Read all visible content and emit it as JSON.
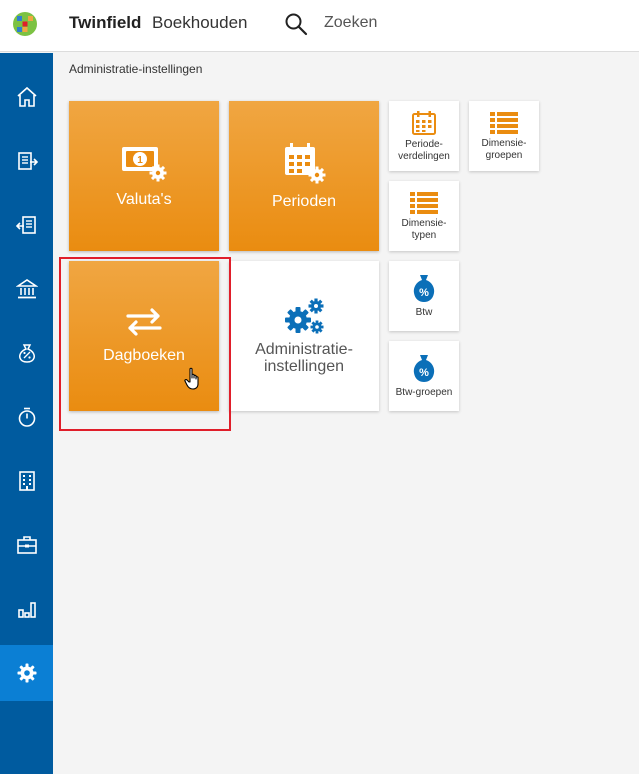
{
  "header": {
    "brand": "Twinfield",
    "product": "Boekhouden",
    "search_label": "Zoeken"
  },
  "breadcrumb": "Administratie-instellingen",
  "sidebar": {
    "items": [
      {
        "icon": "home-icon"
      },
      {
        "icon": "sales-invoice-icon"
      },
      {
        "icon": "purchase-invoice-icon"
      },
      {
        "icon": "bank-icon"
      },
      {
        "icon": "tax-icon"
      },
      {
        "icon": "timer-icon"
      },
      {
        "icon": "building-icon"
      },
      {
        "icon": "briefcase-icon"
      },
      {
        "icon": "reports-icon"
      },
      {
        "icon": "settings-icon",
        "active": true
      }
    ]
  },
  "tiles": {
    "valuta": "Valuta's",
    "perioden": "Perioden",
    "dagboeken": "Dagboeken",
    "administratie": "Administratie-\ninstellingen",
    "periodeverdelingen": "Periode-\nverdelingen",
    "dimensiegroepen": "Dimensie-\ngroepen",
    "dimensietypen": "Dimensie-\ntypen",
    "btw": "Btw",
    "btwgroepen": "Btw-groepen"
  },
  "colors": {
    "sidebar": "#005b9f",
    "sidebar_active": "#0b7fd4",
    "tile_orange": "#ea8c10",
    "icon_blue": "#0b6fb8",
    "highlight": "#e01e2a"
  }
}
